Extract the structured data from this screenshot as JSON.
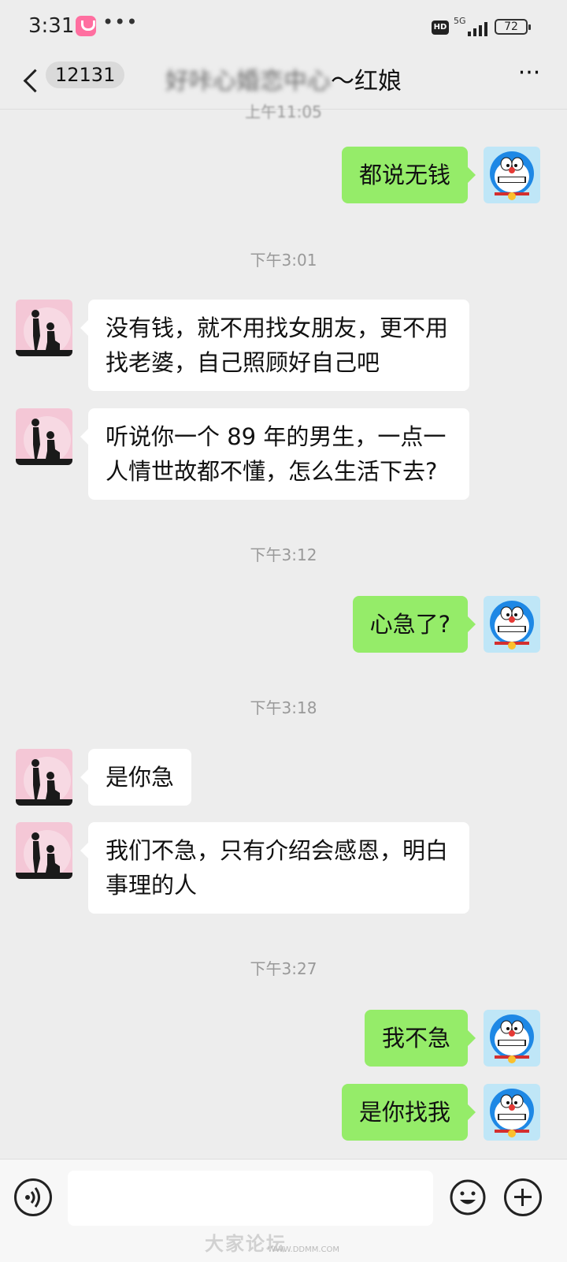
{
  "status_bar": {
    "time": "3:31",
    "dots": "•••",
    "hd": "HD",
    "network": "5G",
    "battery": "72"
  },
  "header": {
    "unread_count": "12131",
    "title_blurred": "好咔心婚恋中心",
    "title_suffix": "～红娘",
    "top_partial_timestamp": "上午11:05"
  },
  "messages": [
    {
      "side": "out",
      "text": "都说无钱"
    },
    {
      "type": "time",
      "text": "下午3:01"
    },
    {
      "side": "in",
      "text": "没有钱，就不用找女朋友，更不用找老婆，自己照顾好自己吧"
    },
    {
      "side": "in",
      "text": "听说你一个 89 年的男生，一点一人情世故都不懂，怎么生活下去?"
    },
    {
      "type": "time",
      "text": "下午3:12"
    },
    {
      "side": "out",
      "text": "心急了?"
    },
    {
      "type": "time",
      "text": "下午3:18"
    },
    {
      "side": "in",
      "text": "是你急"
    },
    {
      "side": "in",
      "text": "我们不急，只有介绍会感恩，明白事理的人"
    },
    {
      "type": "time",
      "text": "下午3:27"
    },
    {
      "side": "out",
      "text": "我不急"
    },
    {
      "side": "out",
      "text": "是你找我"
    }
  ],
  "input_bar": {
    "placeholder": "",
    "value": ""
  },
  "watermark": {
    "text": "大家论坛",
    "url": "WWW.DDMM.COM"
  },
  "colors": {
    "background": "#ededed",
    "outgoing_bubble": "#95ec69",
    "incoming_bubble": "#ffffff"
  }
}
